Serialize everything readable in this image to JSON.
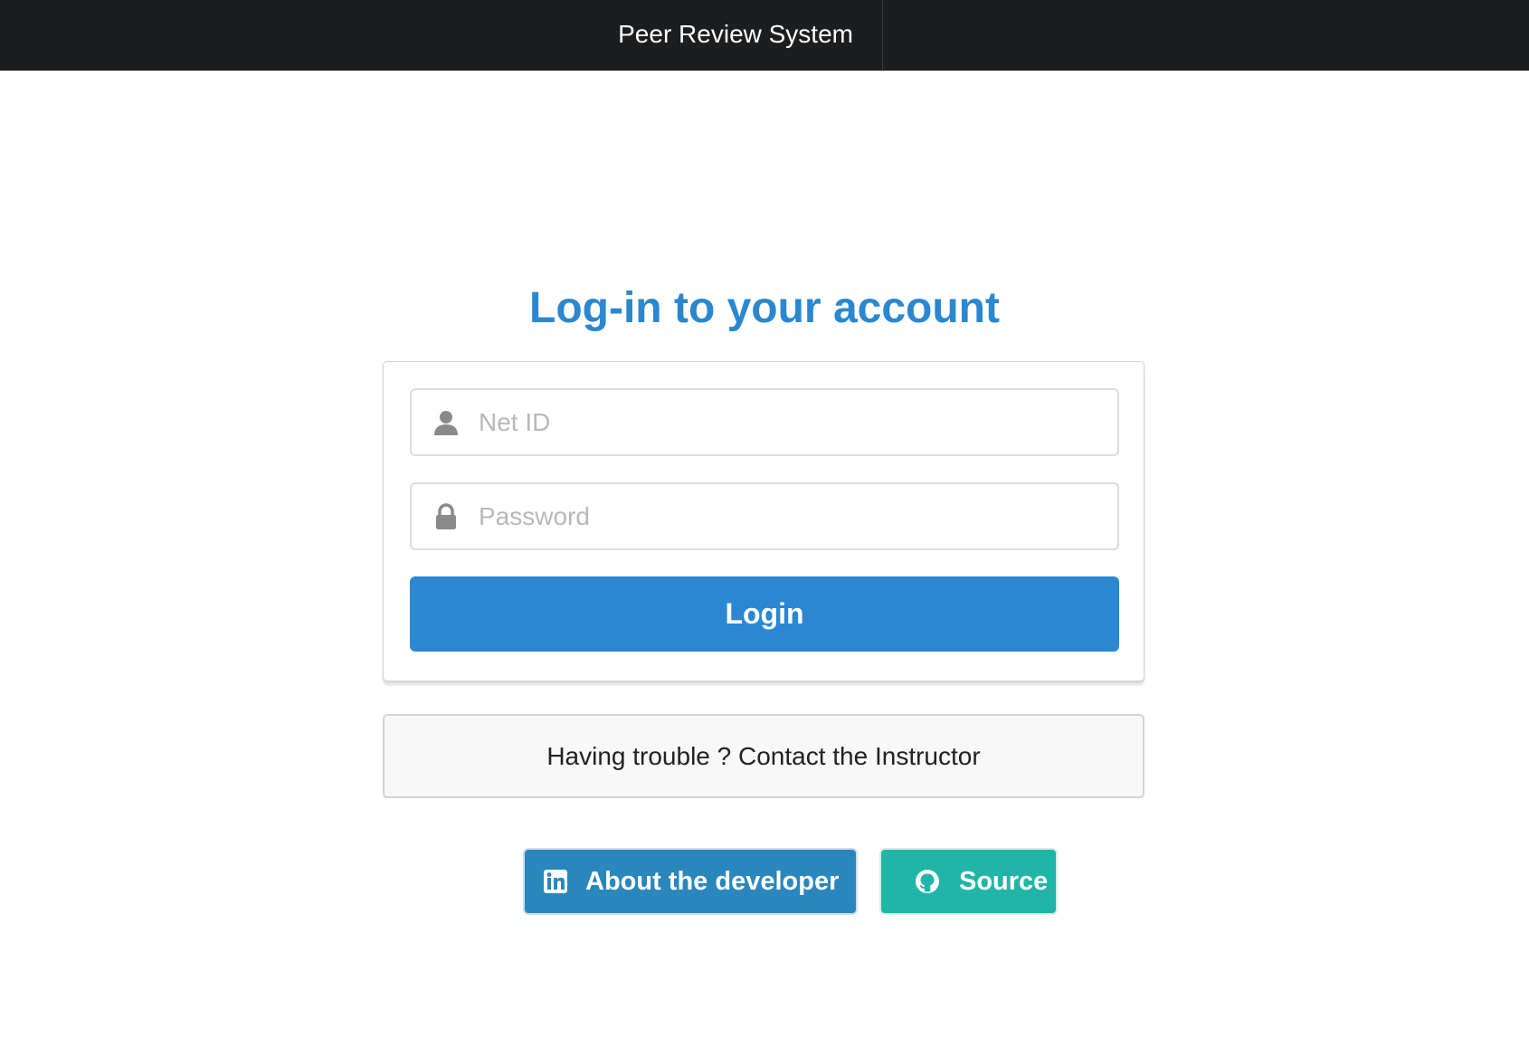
{
  "header": {
    "title": "Peer Review System"
  },
  "login": {
    "heading": "Log-in to your account",
    "netid": {
      "placeholder": "Net ID",
      "value": "",
      "icon": "user-icon"
    },
    "password": {
      "placeholder": "Password",
      "value": "",
      "icon": "lock-icon"
    },
    "submit_label": "Login"
  },
  "help": {
    "text": "Having trouble ? Contact the Instructor"
  },
  "links": {
    "developer_label": "About the developer",
    "developer_icon": "linkedin-icon",
    "source_label": "Source",
    "source_icon": "github-icon"
  },
  "colors": {
    "accent": "#2a87d0",
    "topbar": "#1c1d1f",
    "developer_button": "#2a87bd",
    "source_button": "#21b5a8"
  }
}
